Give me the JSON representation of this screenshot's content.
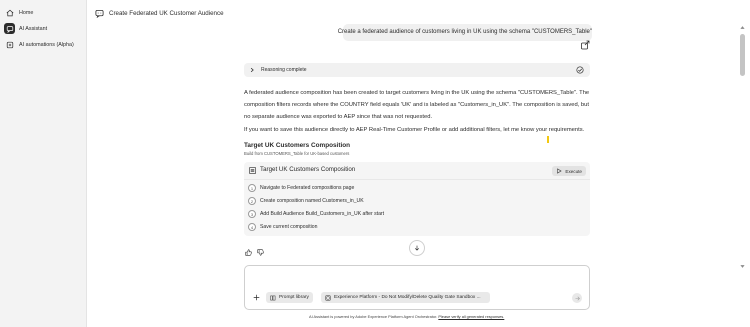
{
  "sidebar": {
    "items": [
      {
        "label": "Home",
        "icon": "home-icon",
        "active": false
      },
      {
        "label": "AI Assistant",
        "icon": "ai-assistant-icon",
        "active": true
      },
      {
        "label": "AI automations (Alpha)",
        "icon": "automations-icon",
        "active": false
      }
    ]
  },
  "header": {
    "title": "Create Federated UK Customer Audience",
    "icon": "chat-icon"
  },
  "chat": {
    "user_message": "Create a federated audience of customers living in UK using the schema \"CUSTOMERS_Table\"",
    "reasoning_label": "Reasoning complete",
    "response_paragraph_1": "A federated audience composition has been created to target customers living in the UK using the schema \"CUSTOMERS_Table\". The composition filters records where the COUNTRY field equals 'UK' and is labeled as \"Customers_in_UK\". The composition is saved, but no separate audience was exported to AEP since that was not requested.",
    "response_paragraph_2": "If you want to save this audience directly to AEP Real-Time Customer Profile or add additional filters, let me know your requirements.",
    "composition_title": "Target UK Customers Composition",
    "composition_subtitle": "Build from CUSTOMERS_Table for UK-based customers"
  },
  "composition_card": {
    "title": "Target UK Customers Composition",
    "execute_label": "Execute",
    "steps": [
      {
        "num": "1",
        "text": "Navigate to Federated compositions page"
      },
      {
        "num": "2",
        "text": "Create composition named Customers_in_UK"
      },
      {
        "num": "3",
        "text": "Add Build Audience Build_Customers_in_UK after start"
      },
      {
        "num": "4",
        "text": "Save current composition"
      }
    ]
  },
  "composer": {
    "prompt_library_label": "Prompt library",
    "sandbox_chip_label": "Experience Platform - Do Not Modify/Delete Quality Gate Sandbox ..."
  },
  "footer": {
    "text": "AI Assistant is powered by Adobe Experience Platform Agent Orchestrator.",
    "link": "Please verify all generated responses."
  },
  "colors": {
    "sidebar_bg": "#f3f3f3",
    "accent_dark": "#2c2c2c",
    "bubble_bg": "#f0f0f0",
    "cursor_highlight": "#f2c811"
  }
}
